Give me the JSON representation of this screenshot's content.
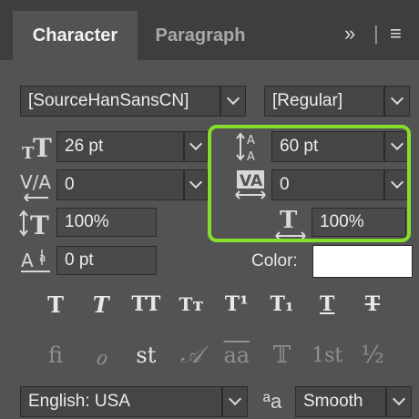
{
  "tabs": {
    "character": "Character",
    "paragraph": "Paragraph"
  },
  "panel_menu": {
    "expand_glyph": "»",
    "separator": "|",
    "menu_glyph": "≡"
  },
  "font": {
    "family": "[SourceHanSansCN]",
    "style": "[Regular]"
  },
  "metrics": {
    "size": "26 pt",
    "leading": "60 pt",
    "kerning": "0",
    "tracking": "0",
    "vertical_scale": "100%",
    "horizontal_scale": "100%",
    "baseline_shift": "0 pt"
  },
  "color_label": "Color:",
  "colors": {
    "swatch": "#ffffff",
    "highlight": "#86de2c"
  },
  "icons": {
    "size": "font-size-icon",
    "leading": "leading-icon",
    "kerning": "kerning-icon",
    "tracking": "tracking-icon",
    "vertical_scale": "vertical-scale-icon",
    "horizontal_scale": "horizontal-scale-icon",
    "baseline_shift": "baseline-shift-icon",
    "anti_alias": "anti-alias-icon"
  },
  "style_buttons": [
    "T",
    "T",
    "TT",
    "Tт",
    "T¹",
    "T₁",
    "T",
    "T"
  ],
  "opentype_buttons": [
    "fi",
    "ℴ",
    "st",
    "𝒜",
    "aa",
    "𝕋",
    "1st",
    "½"
  ],
  "language": "English: USA",
  "anti_alias_glyph": "ªa",
  "anti_alias": "Smooth"
}
